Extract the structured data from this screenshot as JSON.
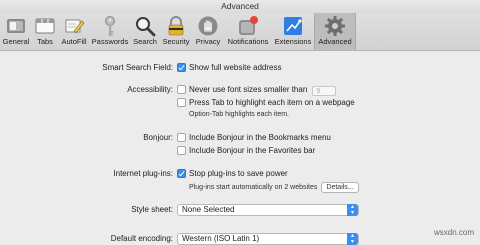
{
  "window": {
    "title": "Advanced"
  },
  "toolbar": {
    "items": [
      {
        "label": "General",
        "icon": "general-switch-icon"
      },
      {
        "label": "Tabs",
        "icon": "tabs-icon"
      },
      {
        "label": "AutoFill",
        "icon": "autofill-pencil-icon"
      },
      {
        "label": "Passwords",
        "icon": "key-icon"
      },
      {
        "label": "Search",
        "icon": "magnifier-icon"
      },
      {
        "label": "Security",
        "icon": "padlock-icon"
      },
      {
        "label": "Privacy",
        "icon": "hand-icon"
      },
      {
        "label": "Notifications",
        "icon": "notifications-icon"
      },
      {
        "label": "Extensions",
        "icon": "puzzle-icon"
      },
      {
        "label": "Advanced",
        "icon": "gear-icon"
      }
    ]
  },
  "smart_search": {
    "label": "Smart Search Field:",
    "option": "Show full website address",
    "checked": true
  },
  "accessibility": {
    "label": "Accessibility:",
    "option1": "Never use font sizes smaller than",
    "font_size": "9",
    "option2": "Press Tab to highlight each item on a webpage",
    "note": "Option-Tab highlights each item."
  },
  "bonjour": {
    "label": "Bonjour:",
    "option1": "Include Bonjour in the Bookmarks menu",
    "option2": "Include Bonjour in the Favorites bar"
  },
  "plugins": {
    "label": "Internet plug-ins:",
    "option": "Stop plug-ins to save power",
    "checked": true,
    "note": "Plug-ins start automatically on 2 websites",
    "details_button": "Details..."
  },
  "stylesheet": {
    "label": "Style sheet:",
    "value": "None Selected"
  },
  "encoding": {
    "label": "Default encoding:",
    "value": "Western (ISO Latin 1)"
  },
  "watermark": "wsxdn.com",
  "colors": {
    "accent": "#3b8ef0",
    "background": "#ececec",
    "active_tab": "#bdbdbd"
  }
}
